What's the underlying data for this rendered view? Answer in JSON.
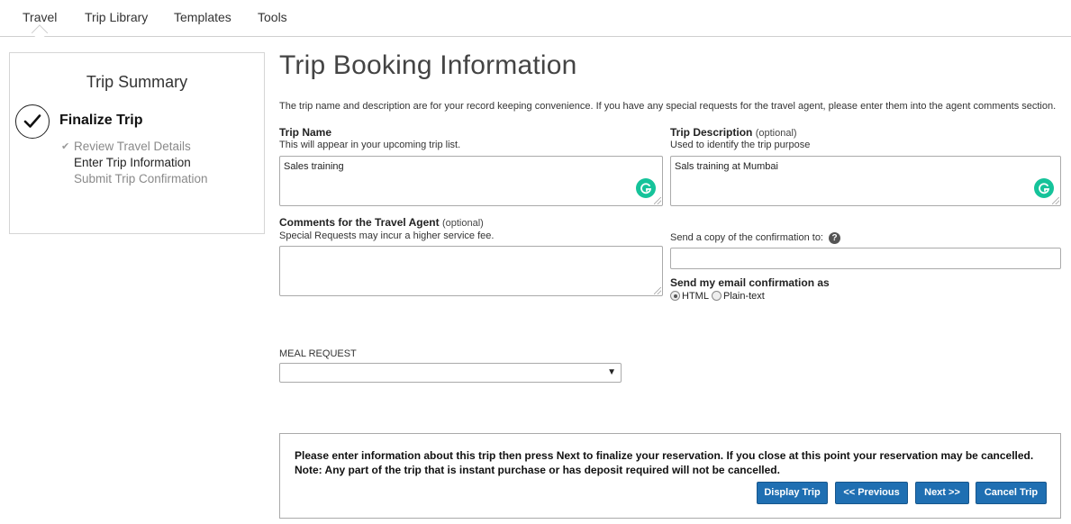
{
  "nav": {
    "tabs": [
      {
        "label": "Travel",
        "active": true
      },
      {
        "label": "Trip Library"
      },
      {
        "label": "Templates"
      },
      {
        "label": "Tools"
      }
    ]
  },
  "sidebar": {
    "title": "Trip Summary",
    "step_title": "Finalize Trip",
    "substeps": [
      {
        "label": "Review Travel Details",
        "state": "done"
      },
      {
        "label": "Enter Trip Information",
        "state": "current"
      },
      {
        "label": "Submit Trip Confirmation",
        "state": "todo"
      }
    ]
  },
  "main": {
    "title": "Trip Booking Information",
    "intro": "The trip name and description are for your record keeping convenience. If you have any special requests for the travel agent, please enter them into the agent comments section.",
    "trip_name": {
      "label": "Trip Name",
      "hint": "This will appear in your upcoming trip list.",
      "value": "Sales training"
    },
    "trip_description": {
      "label": "Trip Description",
      "optional": "(optional)",
      "hint": "Used to identify the trip purpose",
      "value": "Sals training at Mumbai"
    },
    "comments": {
      "label": "Comments for the Travel Agent",
      "optional": "(optional)",
      "hint": "Special Requests may incur a higher service fee.",
      "value": ""
    },
    "copy_to": {
      "label": "Send a copy of the confirmation to:",
      "help": "?",
      "value": ""
    },
    "email_format": {
      "label": "Send my email confirmation as",
      "options": [
        "HTML",
        "Plain-text"
      ],
      "selected": "HTML"
    },
    "meal": {
      "label": "MEAL REQUEST",
      "value": ""
    }
  },
  "notice": {
    "line1": "Please enter information about this trip then press Next to finalize your reservation. If you close at this point your reservation may be cancelled.",
    "line2": "Note: Any part of the trip that is instant purchase or has deposit required will not be cancelled."
  },
  "buttons": {
    "display_trip": "Display Trip",
    "previous": "<< Previous",
    "next": "Next >>",
    "cancel_trip": "Cancel Trip"
  },
  "colors": {
    "button": "#1f6fb2",
    "grammarly": "#15c39a"
  }
}
